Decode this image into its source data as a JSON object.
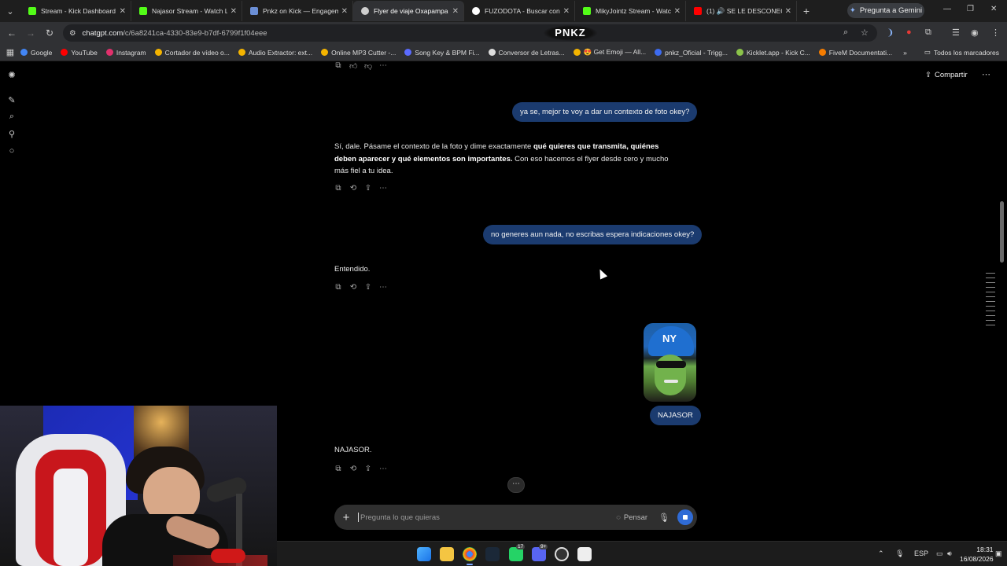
{
  "browser": {
    "tabs": [
      {
        "title": "Stream - Kick Dashboard",
        "color": "#53fc18"
      },
      {
        "title": "Najasor Stream - Watch Li",
        "color": "#53fc18"
      },
      {
        "title": "Pnkz on Kick — Engageme",
        "color": "#6b8fd6"
      },
      {
        "title": "Flyer de viaje Oxapampa",
        "color": "#cfcfcf",
        "active": true
      },
      {
        "title": "FUZODOTA - Buscar con G",
        "color": "#ffffff"
      },
      {
        "title": "MikyJointz Stream - Watch",
        "color": "#53fc18"
      },
      {
        "title": "(1) 🔊 SE LE DESCONECTA",
        "color": "#ff0000"
      }
    ],
    "gemini_label": "Pregunta a Gemini",
    "url_host": "chatgpt.com",
    "url_path": "/c/6a8241ca-4330-83e9-b7df-6799f1f04eee",
    "overlay_logo": "PNKZ",
    "bookmarks": [
      {
        "label": "Google",
        "color": "#4285f4"
      },
      {
        "label": "YouTube",
        "color": "#ff0000"
      },
      {
        "label": "Instagram",
        "color": "#e1306c"
      },
      {
        "label": "Cortador de vídeo o...",
        "color": "#f4b400"
      },
      {
        "label": "Audio Extractor: ext...",
        "color": "#f4b400"
      },
      {
        "label": "Online MP3 Cutter -...",
        "color": "#f4b400"
      },
      {
        "label": "Song Key & BPM Fi...",
        "color": "#5b6bff"
      },
      {
        "label": "Conversor de Letras...",
        "color": "#dddddd"
      },
      {
        "label": "😍 Get Emoji — All...",
        "color": "#f4b400"
      },
      {
        "label": "pnkz_Oficial - Trigg...",
        "color": "#3d6bf0"
      },
      {
        "label": "Kicklet.app - Kick C...",
        "color": "#8bc34a"
      },
      {
        "label": "FiveM Documentati...",
        "color": "#f57c00"
      }
    ],
    "bookmarks_folder": "Todos los marcadores"
  },
  "chat": {
    "share_label": "Compartir",
    "messages": [
      {
        "role": "user",
        "text": "ya se, mejor te voy a dar un contexto de foto okey?"
      },
      {
        "role": "assistant",
        "pre": "Sí, dale. Pásame el contexto de la foto y dime exactamente ",
        "bold": "qué quieres que transmita, quiénes deben aparecer y qué elementos son importantes.",
        "post": " Con eso hacemos el flyer desde cero y mucho más fiel a tu idea."
      },
      {
        "role": "user",
        "text": "no generes aun nada, no escribas espera indicaciones okey?"
      },
      {
        "role": "assistant",
        "text": "Entendido."
      },
      {
        "role": "user",
        "text": "NAJASOR",
        "has_image": true,
        "image_icon": "yankees-cap-mask-photo"
      },
      {
        "role": "assistant",
        "text": "NAJASOR."
      }
    ],
    "composer": {
      "placeholder": "Pregunta lo que quieras",
      "pensar_label": "Pensar"
    }
  },
  "taskbar": {
    "lang": "ESP",
    "time": "18:31",
    "date": "16/08/2026",
    "badges": {
      "whatsapp": "17",
      "discord": "9+"
    }
  }
}
